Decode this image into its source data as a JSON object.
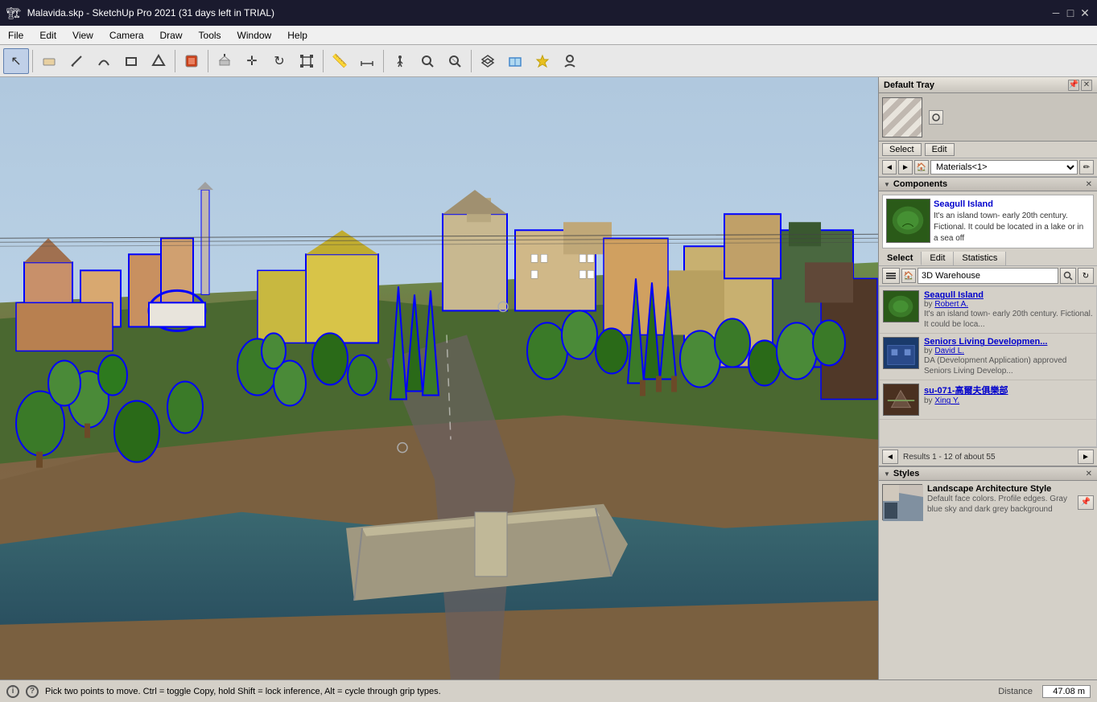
{
  "titlebar": {
    "icon": "sketchup-icon",
    "title": "Malavida.skp - SketchUp Pro 2021 (31 days left in TRIAL)",
    "minimize": "─",
    "maximize": "□",
    "close": "✕"
  },
  "menubar": {
    "items": [
      "File",
      "Edit",
      "View",
      "Camera",
      "Draw",
      "Tools",
      "Window",
      "Help"
    ]
  },
  "toolbar": {
    "tools": [
      {
        "name": "select-tool",
        "icon": "↖"
      },
      {
        "name": "eraser-tool",
        "icon": "⬜"
      },
      {
        "name": "pencil-tool",
        "icon": "✏"
      },
      {
        "name": "rectangle-tool",
        "icon": "▭"
      },
      {
        "name": "paint-tool",
        "icon": "⬛"
      },
      {
        "name": "push-pull-tool",
        "icon": "⬜"
      },
      {
        "name": "move-tool",
        "icon": "✛"
      },
      {
        "name": "rotate-tool",
        "icon": "↻"
      },
      {
        "name": "resize-tool",
        "icon": "⬜"
      },
      {
        "name": "tape-tool",
        "icon": "📏"
      },
      {
        "name": "dimension-tool",
        "icon": "⊢"
      },
      {
        "name": "walk-tool",
        "icon": "⊕"
      },
      {
        "name": "zoom-tool",
        "icon": "🔍"
      },
      {
        "name": "pan-tool",
        "icon": "⊞"
      },
      {
        "name": "orbit-tool",
        "icon": "⊕"
      },
      {
        "name": "section-tool",
        "icon": "⊟"
      },
      {
        "name": "layers-tool",
        "icon": "⊠"
      },
      {
        "name": "shadow-tool",
        "icon": "☀"
      },
      {
        "name": "profile-tool",
        "icon": "👤"
      }
    ]
  },
  "right_panel": {
    "default_tray": {
      "title": "Default Tray",
      "pin_icon": "📌",
      "close_icon": "✕"
    },
    "materials": {
      "select_label": "Select",
      "edit_label": "Edit",
      "dropdown_value": "Materials<1>",
      "nav_back": "◄",
      "nav_forward": "►",
      "home": "🏠",
      "pencil_icon": "✏"
    },
    "components": {
      "section_title": "Components",
      "close_icon": "✕",
      "arrow": "▼",
      "selected_component": {
        "title": "Seagull Island",
        "description": "It's an island town- early 20th century. Fictional. It could be located in a lake or in a sea off"
      },
      "tabs": [
        "Select",
        "Edit",
        "Statistics"
      ],
      "active_tab": "Select",
      "search": {
        "placeholder": "3D Warehouse",
        "search_icon": "🔍",
        "refresh_icon": "↻"
      },
      "results": [
        {
          "title": "Seagull Island",
          "author_prefix": "by ",
          "author": "Robert A.",
          "description": "It's an island town- early 20th century. Fictional. It could be loca...",
          "thumb_type": "green"
        },
        {
          "title": "Seniors Living Developmen...",
          "author_prefix": "by ",
          "author": "David L.",
          "description": "DA (Development Application) approved Seniors Living Develop...",
          "thumb_type": "blue"
        },
        {
          "title": "su-071-高爾夫俱樂部",
          "author_prefix": "by ",
          "author": "Xing Y.",
          "description": "",
          "thumb_type": "brown"
        }
      ],
      "scroll_back": "◄",
      "results_count": "Results 1 - 12 of about 55"
    },
    "styles": {
      "section_title": "Styles",
      "close_icon": "✕",
      "arrow": "▼",
      "selected_style": {
        "title": "Landscape Architecture Style",
        "description": "Default face colors. Profile edges. Gray blue sky and dark grey background"
      },
      "pencil_icon": "✏",
      "pin_icon": "📌"
    }
  },
  "statusbar": {
    "info_icon": "i",
    "hint_icon": "❓",
    "status_text": "Pick two points to move.  Ctrl = toggle Copy, hold Shift = lock inference, Alt = cycle through grip types.",
    "distance_label": "Distance",
    "distance_value": "47.08 m"
  }
}
